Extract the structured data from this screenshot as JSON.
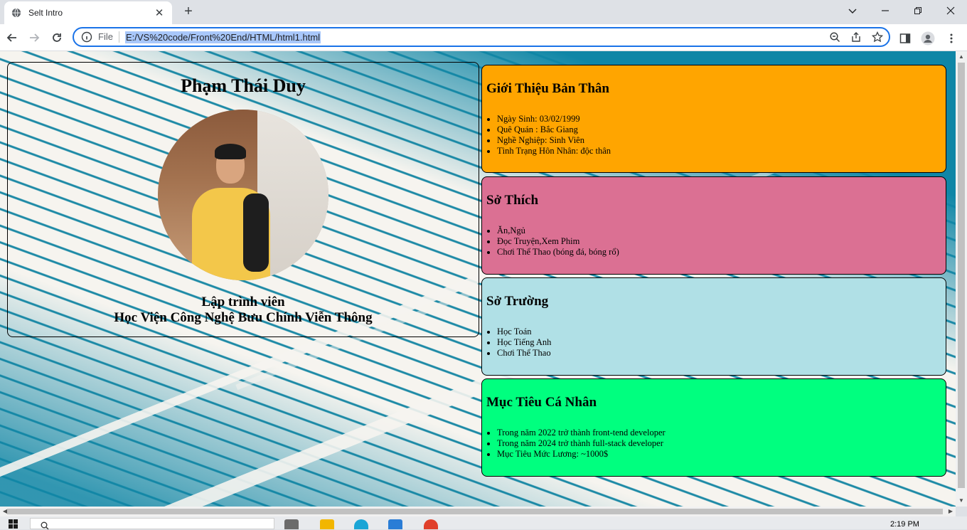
{
  "browser": {
    "tab_title": "Selt Intro",
    "scheme_label": "File",
    "url": "E:/VS%20code/Front%20End/HTML/html1.html"
  },
  "profile": {
    "name": "Phạm Thái Duy",
    "role_line1": "Lập trình viên",
    "role_line2": "Học Viện Công Nghệ Bưu Chính Viễn Thông"
  },
  "sections": {
    "intro": {
      "title": "Giới Thiệu Bản Thân",
      "color": "#ffa500",
      "items": [
        "Ngày Sinh: 03/02/1999",
        "Quê Quán : Bắc Giang",
        "Nghề Nghiệp: Sinh Viên",
        "Tình Trạng Hôn Nhân: độc thân"
      ]
    },
    "hobbies": {
      "title": "Sở Thích",
      "color": "#db7093",
      "items": [
        "Ăn,Ngủ",
        "Đọc Truyện,Xem Phim",
        "Chơi Thể Thao (bóng đá, bóng rổ)"
      ]
    },
    "strengths": {
      "title": "Sở Trường",
      "color": "#b0e0e6",
      "items": [
        "Học Toán",
        "Học Tiếng Anh",
        "Chơi Thể Thao"
      ]
    },
    "goals": {
      "title": "Mục Tiêu Cá Nhân",
      "color": "#00ff7f",
      "items": [
        "Trong năm 2022 trở thành front-tend developer",
        "Trong năm 2024 trở thành full-stack developer",
        "Mục Tiêu Mức Lương: ~1000$"
      ]
    }
  },
  "taskbar": {
    "clock": "2:19 PM"
  }
}
